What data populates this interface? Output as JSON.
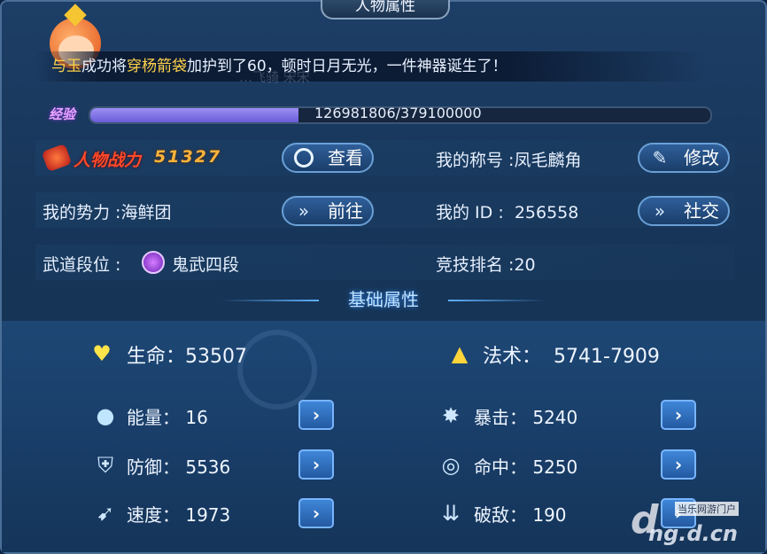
{
  "window": {
    "title": "人物属性"
  },
  "announcement": {
    "name": "与玉",
    "part1": "成功将",
    "item": "穿杨箭袋",
    "part2": "加护到了60，顿时日月无光，一件神器诞生了！",
    "faint_overlay": "…飞骑 宋宋"
  },
  "experience": {
    "label": "经验",
    "current": 126981806,
    "max": 379100000,
    "text": "126981806/379100000",
    "fill_percent": 33.5
  },
  "power": {
    "label": "人物战力",
    "value": "51327"
  },
  "buttons": {
    "view": "查看",
    "modify": "修改",
    "goto": "前往",
    "social": "社交"
  },
  "profile": {
    "title_label": "我的称号",
    "title_value": "凤毛麟角",
    "faction_label": "我的势力",
    "faction_value": "海鲜团",
    "id_label": "我的 ID",
    "id_value": "256558",
    "rank_label": "武道段位",
    "rank_value": "鬼武四段",
    "arena_label": "竞技排名",
    "arena_value": "20"
  },
  "section": {
    "title": "基础属性"
  },
  "attributes": {
    "life": {
      "label": "生命",
      "value": "53507"
    },
    "magic": {
      "label": "法术",
      "value": "5741-7909"
    },
    "energy": {
      "label": "能量",
      "value": "16"
    },
    "crit": {
      "label": "暴击",
      "value": "5240"
    },
    "defense": {
      "label": "防御",
      "value": "5536"
    },
    "hit": {
      "label": "命中",
      "value": "5250"
    },
    "speed": {
      "label": "速度",
      "value": "1973"
    },
    "break": {
      "label": "破敌",
      "value": "190"
    }
  },
  "watermark": {
    "site_label": "当乐网游门户",
    "url": "ng.d.cn"
  },
  "colors": {
    "accent": "#ffd24a",
    "power": "#ff4a2a",
    "exp_fill": "#7d70e6",
    "button": "#2f5f9a"
  }
}
